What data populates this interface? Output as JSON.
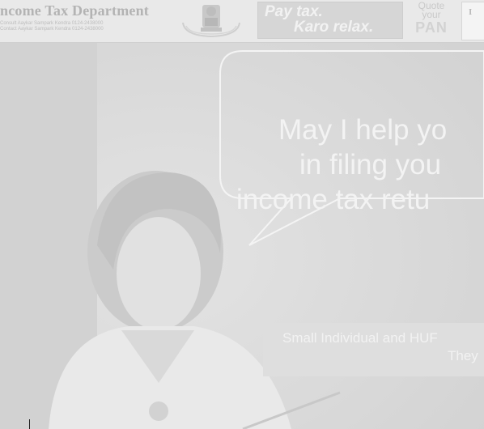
{
  "header": {
    "department_title": "ncome Tax Department",
    "department_subline": "Consult Aaykar Sampark Kendra 0124-2438000",
    "department_line2": "Contact Aaykar Sampark Kendra 0124-2438000",
    "emblem_icon": "state-emblem-icon",
    "slogan_line1": "Pay tax.",
    "slogan_line2": "Karo relax.",
    "quote_line1": "Quote",
    "quote_line2": "your",
    "quote_line3": "PAN",
    "card_letter": "I"
  },
  "banner": {
    "bubble_line1": "May I help yo",
    "bubble_line2": "in filing you",
    "bubble_line3": "income tax retu",
    "caption_line1": "Small Individual and HUF",
    "caption_line2": "They"
  },
  "colors": {
    "header_bg": "#e9e9e9",
    "main_bg": "#d7d7d7",
    "text_light": "#f3f3f3"
  }
}
